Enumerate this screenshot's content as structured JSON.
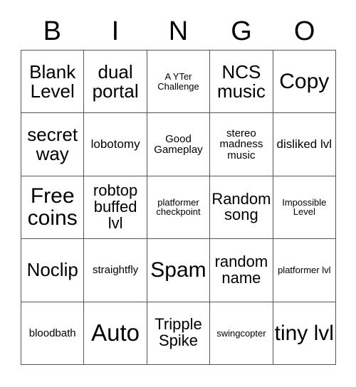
{
  "card": {
    "title": "BINGO",
    "header_letters": [
      "B",
      "I",
      "N",
      "G",
      "O"
    ],
    "colors": {
      "background": "#ffffff",
      "text": "#000000",
      "grid_line": "#555555"
    },
    "grid": {
      "columns": 5,
      "rows": 5,
      "cells": [
        {
          "text": "Blank Level",
          "size": "lg"
        },
        {
          "text": "dual portal",
          "size": "lg"
        },
        {
          "text": "A YTer Challenge",
          "size": "xxs"
        },
        {
          "text": "NCS music",
          "size": "lg"
        },
        {
          "text": "Copy",
          "size": "xl"
        },
        {
          "text": "secret way",
          "size": "lg"
        },
        {
          "text": "lobotomy",
          "size": "sm"
        },
        {
          "text": "Good Gameplay",
          "size": "xs"
        },
        {
          "text": "stereo madness music",
          "size": "xs"
        },
        {
          "text": "disliked lvl",
          "size": "sm"
        },
        {
          "text": "Free coins",
          "size": "xl"
        },
        {
          "text": "robtop buffed lvl",
          "size": "md"
        },
        {
          "text": "platformer checkpoint",
          "size": "xxs"
        },
        {
          "text": "Random song",
          "size": "md"
        },
        {
          "text": "Impossible Level",
          "size": "xxs"
        },
        {
          "text": "Noclip",
          "size": "lg"
        },
        {
          "text": "straightfly",
          "size": "xs"
        },
        {
          "text": "Spam",
          "size": "xl"
        },
        {
          "text": "random name",
          "size": "md"
        },
        {
          "text": "platformer lvl",
          "size": "xxs"
        },
        {
          "text": "bloodbath",
          "size": "xs"
        },
        {
          "text": "Auto",
          "size": "xxl"
        },
        {
          "text": "Tripple Spike",
          "size": "md"
        },
        {
          "text": "swingcopter",
          "size": "xxs"
        },
        {
          "text": "tiny lvl",
          "size": "xl"
        }
      ]
    }
  }
}
